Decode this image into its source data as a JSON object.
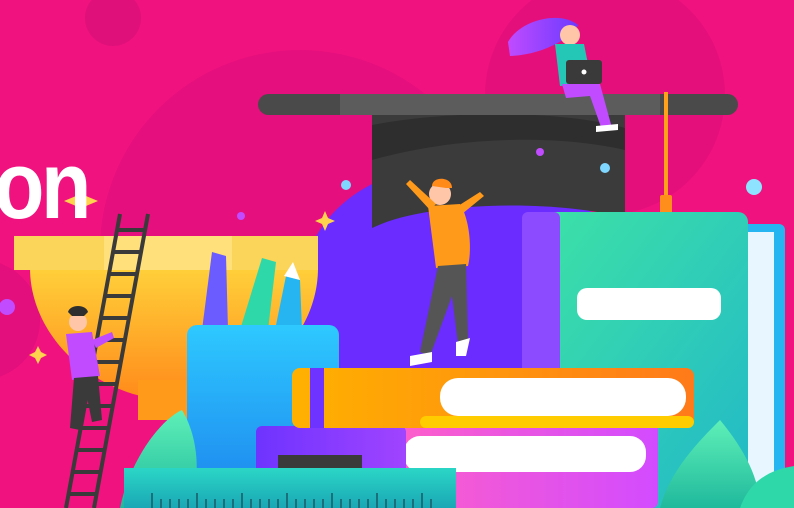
{
  "hero": {
    "title_fragment": "on"
  },
  "palette": {
    "background": "#f0127f",
    "circle_magenta": "#e0107a",
    "blob_purple": "#6a2cff",
    "lamp_yellow": "#fbd45a",
    "lamp_orange": "#ffb300",
    "book_green": "#35d6a9",
    "book_blue": "#27b5f2",
    "cap_dark": "#3b3b3b",
    "sparkle": "#ffd34d"
  },
  "icons": [
    "graduation-cap-icon",
    "ladder-icon",
    "pencil-cup-icon",
    "book-stack-icon",
    "ruler-icon",
    "sparkle-icon"
  ]
}
